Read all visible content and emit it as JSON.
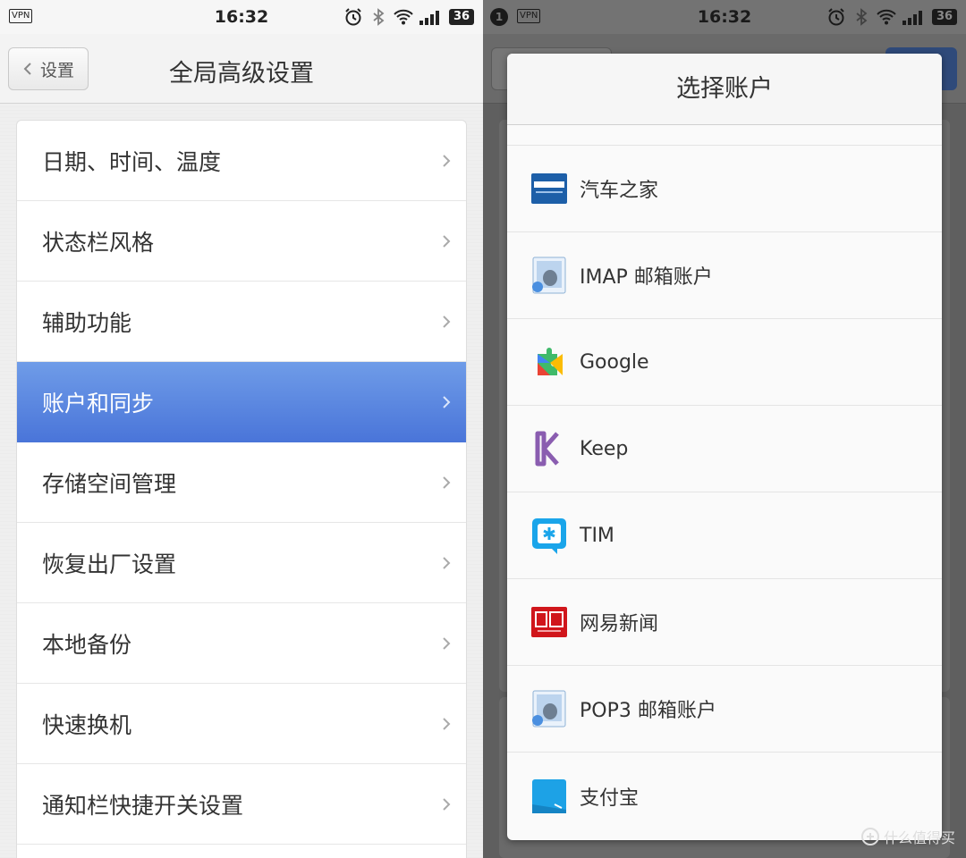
{
  "left_screen": {
    "status": {
      "vpn": "VPN",
      "time": "16:32",
      "battery": "36"
    },
    "header": {
      "back_label": "设置",
      "title": "全局高级设置"
    },
    "items": [
      {
        "label": "日期、时间、温度"
      },
      {
        "label": "状态栏风格"
      },
      {
        "label": "辅助功能"
      },
      {
        "label": "账户和同步",
        "active": true
      },
      {
        "label": "存储空间管理"
      },
      {
        "label": "恢复出厂设置"
      },
      {
        "label": "本地备份"
      },
      {
        "label": "快速换机"
      },
      {
        "label": "通知栏快捷开关设置"
      }
    ],
    "colors": {
      "active_top": "#6f9ce8",
      "active_bottom": "#4a75d9"
    }
  },
  "right_screen": {
    "status": {
      "notification_count": "1",
      "vpn": "VPN",
      "time": "16:32",
      "battery": "36"
    },
    "dialog": {
      "title": "选择账户",
      "accounts": [
        {
          "label": "汽车之家",
          "icon": "autohome-icon"
        },
        {
          "label": "IMAP 邮箱账户",
          "icon": "imap-mail-icon"
        },
        {
          "label": "Google",
          "icon": "google-play-services-icon"
        },
        {
          "label": "Keep",
          "icon": "keep-icon"
        },
        {
          "label": "TIM",
          "icon": "tim-icon"
        },
        {
          "label": "网易新闻",
          "icon": "netease-news-icon"
        },
        {
          "label": "POP3 邮箱账户",
          "icon": "pop3-mail-icon"
        },
        {
          "label": "支付宝",
          "icon": "alipay-icon"
        }
      ]
    }
  },
  "watermark": {
    "text": "什么值得买"
  }
}
